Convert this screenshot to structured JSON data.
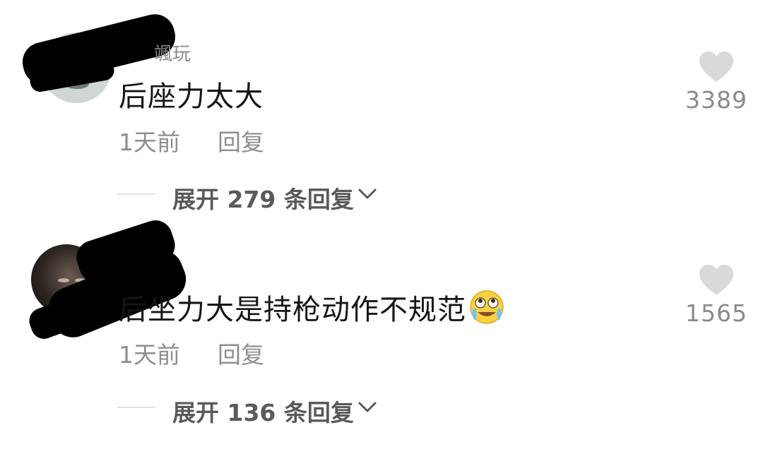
{
  "comments": [
    {
      "username": "颯玩",
      "text": "后座力太大",
      "time": "1天前",
      "reply_label": "回复",
      "expand_label": "展开 279 条回复",
      "likes": "3389",
      "has_emoji": false
    },
    {
      "username": "",
      "text": "后坐力大是持枪动作不规范",
      "time": "1天前",
      "reply_label": "回复",
      "expand_label": "展开 136 条回复",
      "likes": "1565",
      "has_emoji": true,
      "emoji": "laughing-crying-emoji"
    }
  ],
  "colors": {
    "text": "#161616",
    "meta": "#8e8e8e",
    "expand": "#5a5a5a",
    "heart": "#d9d9d9"
  },
  "icons": {
    "like": "heart-icon",
    "expand": "chevron-down-icon"
  }
}
